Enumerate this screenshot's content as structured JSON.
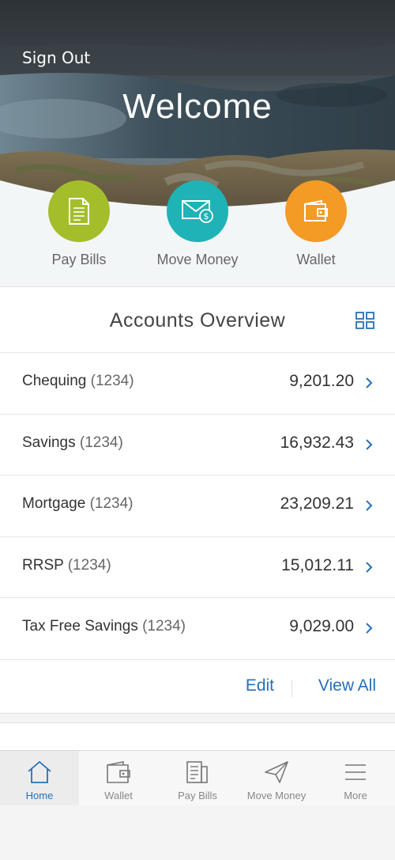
{
  "header": {
    "sign_out": "Sign Out",
    "welcome": "Welcome"
  },
  "quick_actions": [
    {
      "label": "Pay Bills",
      "icon": "bill-document-icon",
      "color": "#a4bd2a"
    },
    {
      "label": "Move Money",
      "icon": "envelope-money-icon",
      "color": "#1fb2b6"
    },
    {
      "label": "Wallet",
      "icon": "wallet-icon",
      "color": "#f49b26"
    }
  ],
  "overview": {
    "title": "Accounts Overview",
    "accounts": [
      {
        "name": "Chequing",
        "number": "(1234)",
        "balance": "9,201.20"
      },
      {
        "name": "Savings",
        "number": "(1234)",
        "balance": "16,932.43"
      },
      {
        "name": "Mortgage",
        "number": "(1234)",
        "balance": "23,209.21"
      },
      {
        "name": "RRSP",
        "number": "(1234)",
        "balance": "15,012.11"
      },
      {
        "name": "Tax Free Savings",
        "number": "(1234)",
        "balance": "9,029.00"
      }
    ],
    "edit": "Edit",
    "view_all": "View All"
  },
  "tabs": [
    {
      "label": "Home",
      "icon": "home-icon",
      "active": true
    },
    {
      "label": "Wallet",
      "icon": "wallet-icon",
      "active": false
    },
    {
      "label": "Pay Bills",
      "icon": "bill-icon",
      "active": false
    },
    {
      "label": "Move Money",
      "icon": "paper-plane-icon",
      "active": false
    },
    {
      "label": "More",
      "icon": "menu-icon",
      "active": false
    }
  ],
  "colors": {
    "accent": "#2670b8",
    "pay_bills": "#a4bd2a",
    "move_money": "#1fb2b6",
    "wallet": "#f49b26"
  }
}
